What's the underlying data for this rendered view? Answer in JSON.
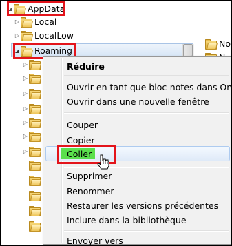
{
  "tree": {
    "appdata_label": "AppData",
    "local_label": "Local",
    "locallow_label": "LocalLow",
    "roaming_label": "Roaming"
  },
  "right_pane": {
    "item1": "No",
    "item2": "N"
  },
  "context_menu": {
    "reduire": "Réduire",
    "open_onenote": "Ouvrir en tant que bloc-notes dans OneNote",
    "open_new_window": "Ouvrir dans une nouvelle fenêtre",
    "couper": "Couper",
    "copier": "Copier",
    "coller": "Coller",
    "supprimer": "Supprimer",
    "renommer": "Renommer",
    "restaurer": "Restaurer les versions précédentes",
    "inclure": "Inclure dans la bibliothèque",
    "envoyer": "Envoyer vers"
  },
  "colors": {
    "highlight_box": "#e3141b",
    "coller_highlight": "#5ae04c"
  }
}
